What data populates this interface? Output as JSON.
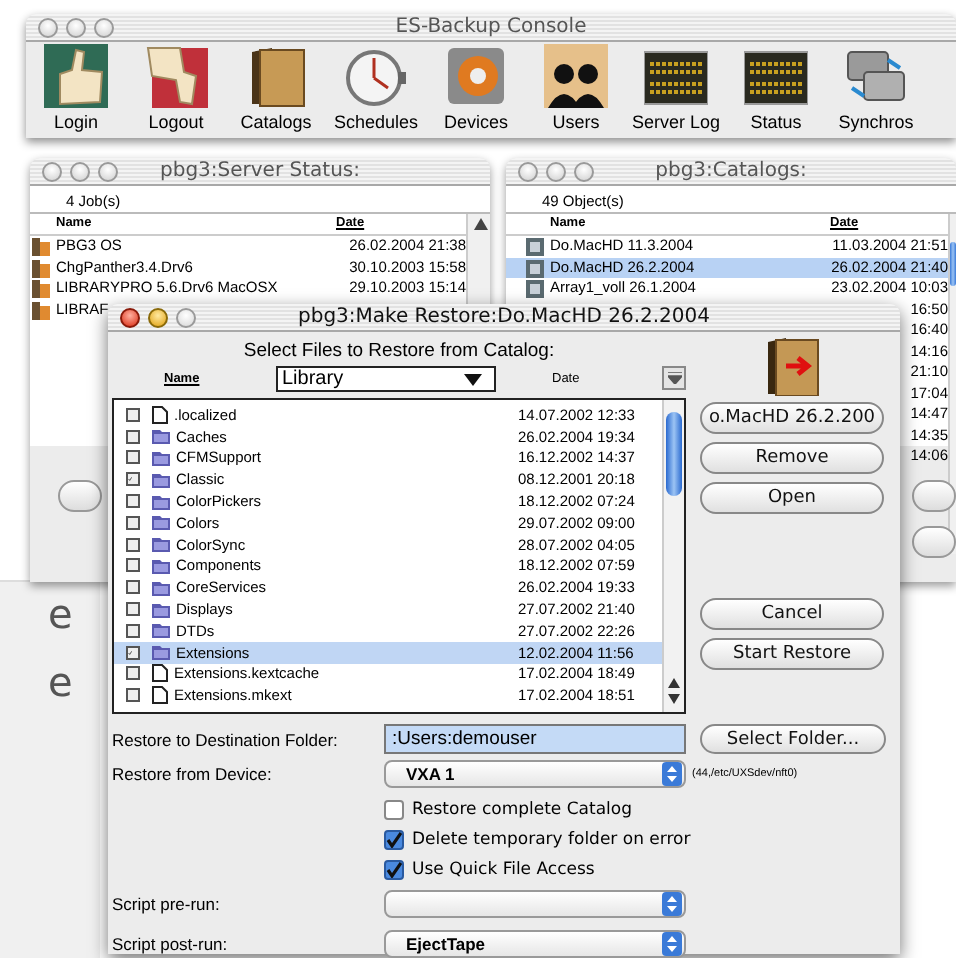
{
  "console": {
    "title": "ES-Backup Console",
    "active": false,
    "toolbar": [
      {
        "label": "Login",
        "kind": "thumbs-up"
      },
      {
        "label": "Logout",
        "kind": "thumbs-down"
      },
      {
        "label": "Catalogs",
        "kind": "book"
      },
      {
        "label": "Schedules",
        "kind": "stopwatch"
      },
      {
        "label": "Devices",
        "kind": "disk"
      },
      {
        "label": "Users",
        "kind": "people"
      },
      {
        "label": "Server Log",
        "kind": "led"
      },
      {
        "label": "Status",
        "kind": "led"
      },
      {
        "label": "Synchros",
        "kind": "drives"
      }
    ]
  },
  "server_status": {
    "title": "pbg3:Server Status:",
    "active": false,
    "count": "4 Job(s)",
    "columns": [
      "Name",
      "Date"
    ],
    "rows": [
      {
        "name": "PBG3 OS",
        "date": "26.02.2004 21:38",
        "selected": false
      },
      {
        "name": "ChgPanther3.4.Drv6",
        "date": "30.10.2003 15:58",
        "selected": false
      },
      {
        "name": "LIBRARYPRO 5.6.Drv6 MacOSX",
        "date": "29.10.2003 15:14",
        "selected": false
      },
      {
        "name": "LIBRAF",
        "selected": false
      }
    ]
  },
  "catalogs": {
    "title": "pbg3:Catalogs:",
    "active": false,
    "count": "49 Object(s)",
    "columns": [
      "Name",
      "Date"
    ],
    "rows": [
      {
        "name": "Do.MacHD 11.3.2004",
        "date": "11.03.2004 21:51",
        "selected": false
      },
      {
        "name": "Do.MacHD 26.2.2004",
        "date": "26.02.2004 21:40",
        "selected": true
      },
      {
        "name": "Array1_voll 26.1.2004",
        "date": "23.02.2004 10:03",
        "selected": false
      },
      {
        "date": "16:50",
        "selected": false
      },
      {
        "date": "16:40",
        "selected": false
      },
      {
        "date": "14:16",
        "selected": false
      },
      {
        "date": "21:10",
        "selected": false
      },
      {
        "date": "17:04",
        "selected": false
      },
      {
        "date": "14:47",
        "selected": false
      },
      {
        "date": "14:35",
        "selected": false
      },
      {
        "date": "14:06",
        "selected": false
      }
    ]
  },
  "make_restore": {
    "title": "pbg3:Make Restore:Do.MacHD 26.2.2004",
    "active": true,
    "heading": "Select Files to Restore from Catalog:",
    "name_column": "Name",
    "folder": "Library",
    "date_column": "Date",
    "files": [
      {
        "name": ".localized",
        "kind": "file",
        "date": "14.07.2002 12:33",
        "checked": false,
        "selected": false
      },
      {
        "name": "Caches",
        "kind": "folder",
        "date": "26.02.2004 19:34",
        "checked": false,
        "selected": false
      },
      {
        "name": "CFMSupport",
        "kind": "folder",
        "date": "16.12.2002 14:37",
        "checked": false,
        "selected": false
      },
      {
        "name": "Classic",
        "kind": "folder",
        "date": "08.12.2001 20:18",
        "checked": true,
        "selected": false
      },
      {
        "name": "ColorPickers",
        "kind": "folder",
        "date": "18.12.2002 07:24",
        "checked": false,
        "selected": false
      },
      {
        "name": "Colors",
        "kind": "folder",
        "date": "29.07.2002 09:00",
        "checked": false,
        "selected": false
      },
      {
        "name": "ColorSync",
        "kind": "folder",
        "date": "28.07.2002 04:05",
        "checked": false,
        "selected": false
      },
      {
        "name": "Components",
        "kind": "folder",
        "date": "18.12.2002 07:59",
        "checked": false,
        "selected": false
      },
      {
        "name": "CoreServices",
        "kind": "folder",
        "date": "26.02.2004 19:33",
        "checked": false,
        "selected": false
      },
      {
        "name": "Displays",
        "kind": "folder",
        "date": "27.07.2002 21:40",
        "checked": false,
        "selected": false
      },
      {
        "name": "DTDs",
        "kind": "folder",
        "date": "27.07.2002 22:26",
        "checked": false,
        "selected": false
      },
      {
        "name": "Extensions",
        "kind": "folder",
        "date": "12.02.2004 11:56",
        "checked": true,
        "selected": true
      },
      {
        "name": "Extensions.kextcache",
        "kind": "file",
        "date": "17.02.2004 18:49",
        "checked": false,
        "selected": false
      },
      {
        "name": "Extensions.mkext",
        "kind": "file",
        "date": "17.02.2004 18:51",
        "checked": false,
        "selected": false
      }
    ],
    "side_buttons": [
      "o.MacHD 26.2.200",
      "Remove",
      "Open"
    ],
    "action_buttons": [
      "Cancel",
      "Start Restore"
    ],
    "destination": {
      "label": "Restore to Destination Folder:",
      "value": ":Users:demouser",
      "button": "Select Folder..."
    },
    "device": {
      "label": "Restore from Device:",
      "value": "VXA 1",
      "info": "(44,/etc/UXSdev/nft0)"
    },
    "options": [
      {
        "label": "Restore complete Catalog",
        "checked": false
      },
      {
        "label": "Delete temporary folder on error",
        "checked": true
      },
      {
        "label": "Use Quick File Access",
        "checked": true
      }
    ],
    "scripts": [
      {
        "label": "Script pre-run:"
      },
      {
        "label": "Script post-run:",
        "value": "EjectTape"
      }
    ]
  },
  "background_text": [
    "e",
    "e"
  ]
}
